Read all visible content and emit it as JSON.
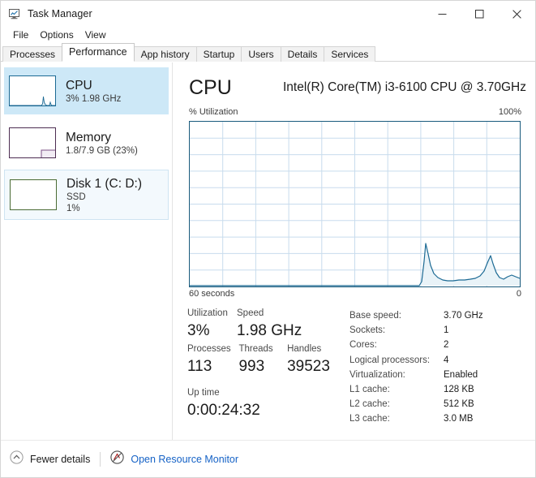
{
  "window": {
    "title": "Task Manager",
    "icon": "task-manager-icon",
    "controls": [
      {
        "name": "minimize",
        "glyph": "–"
      },
      {
        "name": "maximize",
        "glyph": "☐"
      },
      {
        "name": "close",
        "glyph": "✕"
      }
    ]
  },
  "menu": {
    "items": [
      "File",
      "Options",
      "View"
    ]
  },
  "tabs": {
    "items": [
      {
        "label": "Processes",
        "active": false
      },
      {
        "label": "Performance",
        "active": true
      },
      {
        "label": "App history",
        "active": false
      },
      {
        "label": "Startup",
        "active": false
      },
      {
        "label": "Users",
        "active": false
      },
      {
        "label": "Details",
        "active": false
      },
      {
        "label": "Services",
        "active": false
      }
    ],
    "selected": "Performance"
  },
  "sidebar": {
    "items": [
      {
        "title": "CPU",
        "sub1": "3%  1.98 GHz",
        "sub2": "",
        "state": "selected",
        "accent": "#1c6a94",
        "thumb": "cpu-thumbnail-graph"
      },
      {
        "title": "Memory",
        "sub1": "1.8/7.9 GB (23%)",
        "sub2": "",
        "state": "normal",
        "accent": "#4d2d52",
        "thumb": "memory-thumbnail-graph"
      },
      {
        "title": "Disk 1 (C: D:)",
        "sub1": "SSD",
        "sub2": "1%",
        "state": "hovered",
        "accent": "#4a6b34",
        "thumb": "disk-thumbnail-graph"
      }
    ]
  },
  "main": {
    "title": "CPU",
    "model": "Intel(R) Core(TM) i3-6100 CPU @ 3.70GHz",
    "axis_label": "% Utilization",
    "axis_max": "100%",
    "time_span": "60 seconds",
    "time_zero": "0",
    "stats": {
      "group1": [
        {
          "label": "Utilization",
          "value": "3%"
        },
        {
          "label": "Speed",
          "value": "1.98 GHz"
        }
      ],
      "group2": [
        {
          "label": "Processes",
          "value": "113"
        },
        {
          "label": "Threads",
          "value": "993"
        },
        {
          "label": "Handles",
          "value": "39523"
        }
      ],
      "group3": [
        {
          "label": "Up time",
          "value": "0:00:24:32"
        }
      ]
    },
    "specs": [
      {
        "key": "Base speed:",
        "value": "3.70 GHz"
      },
      {
        "key": "Sockets:",
        "value": "1"
      },
      {
        "key": "Cores:",
        "value": "2"
      },
      {
        "key": "Logical processors:",
        "value": "4"
      },
      {
        "key": "Virtualization:",
        "value": "Enabled"
      },
      {
        "key": "L1 cache:",
        "value": "128 KB"
      },
      {
        "key": "L2 cache:",
        "value": "512 KB"
      },
      {
        "key": "L3 cache:",
        "value": "3.0 MB"
      }
    ]
  },
  "footer": {
    "fewer_details": "Fewer details",
    "resource_monitor": "Open Resource Monitor"
  },
  "colors": {
    "graph_line": "#1c6a94",
    "graph_fill": "#e9f3f8",
    "graph_border": "#195a7c",
    "grid": "#c8dced",
    "selection": "#cde8f7",
    "link": "#1562c6"
  },
  "chart_data": {
    "type": "area",
    "title": "% Utilization",
    "xlabel": "60 seconds",
    "ylabel": "% Utilization",
    "xlim": [
      60,
      0
    ],
    "ylim": [
      0,
      100
    ],
    "grid": true,
    "legend": null,
    "series": [
      {
        "name": "CPU utilization",
        "x": [
          60,
          57,
          54,
          51,
          48,
          45,
          42,
          39,
          36,
          33,
          30,
          27,
          24,
          21,
          19,
          18,
          17.4,
          17,
          16.4,
          15.6,
          15,
          14,
          13,
          12,
          11,
          10,
          9,
          8,
          7,
          6.2,
          5.6,
          5,
          4.4,
          4,
          3.4,
          2.8,
          2.2,
          1.4,
          0.8,
          0
        ],
        "values": [
          0,
          0,
          0,
          0,
          0,
          0,
          0,
          0,
          0,
          0,
          0,
          0,
          0,
          0,
          0,
          0,
          3,
          14,
          26,
          21,
          14,
          10,
          7,
          5,
          4,
          3.2,
          3,
          2.8,
          2.8,
          3,
          3.2,
          3.4,
          4,
          5,
          8,
          13,
          9,
          4,
          3,
          4
        ]
      }
    ]
  }
}
